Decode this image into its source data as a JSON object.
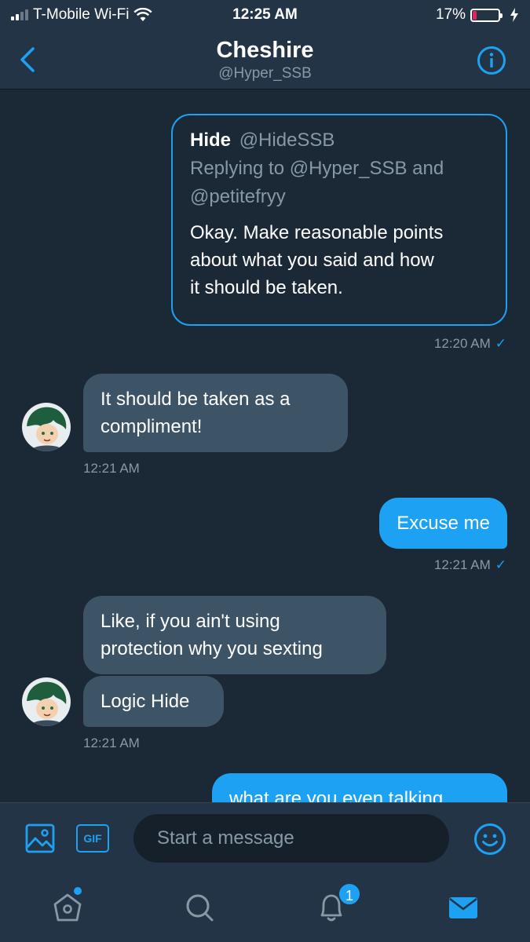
{
  "status_bar": {
    "carrier": "T-Mobile Wi-Fi",
    "time": "12:25 AM",
    "battery": "17%",
    "battery_level": 0.17
  },
  "header": {
    "title": "Cheshire",
    "subtitle": "@Hyper_SSB"
  },
  "quote": {
    "name": "Hide",
    "handle": "@HideSSB",
    "reply_line1": "Replying to @Hyper_SSB and",
    "reply_line2": "@petitefryy",
    "text_line1": "Okay. Make reasonable points",
    "text_line2": "about what you said and how",
    "text_line3": "it should be taken.",
    "time": "12:20 AM"
  },
  "messages": [
    {
      "direction": "in",
      "line1": "It should be taken as a",
      "line2": "compliment!",
      "time": "12:21 AM"
    },
    {
      "direction": "out",
      "text": "Excuse me",
      "time": "12:21 AM"
    },
    {
      "direction": "in",
      "line1": "Like, if you ain't using",
      "line2": "protection why you sexting"
    },
    {
      "direction": "in",
      "text": "Logic Hide",
      "time": "12:21 AM"
    },
    {
      "direction": "out",
      "text": "what are you even talking"
    }
  ],
  "composer": {
    "placeholder": "Start a message",
    "gif_label": "GIF"
  },
  "tabbar": {
    "notifications_count": "1"
  },
  "colors": {
    "accent": "#1da1f2",
    "background": "#1b2836",
    "bar": "#243447",
    "incoming_bubble": "#3d5466",
    "secondary_text": "#8899a6"
  }
}
